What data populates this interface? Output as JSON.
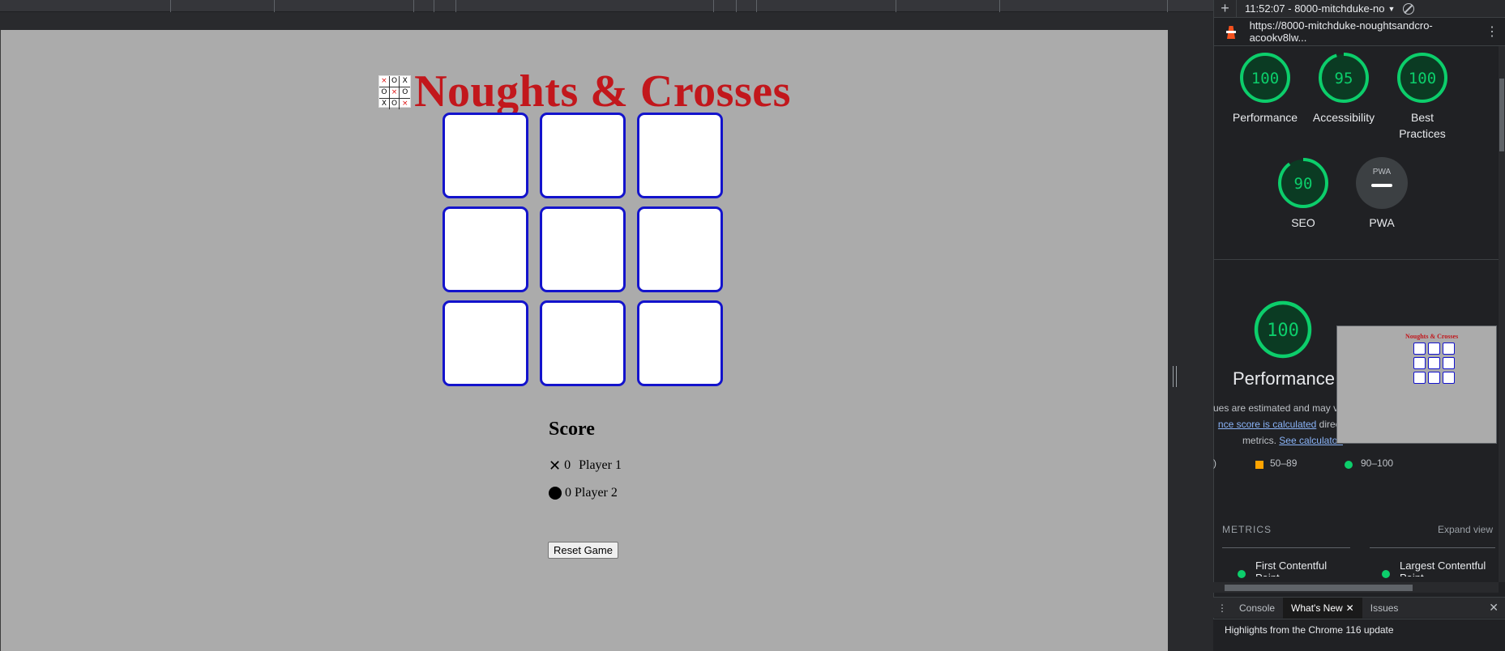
{
  "page": {
    "title": "Noughts & Crosses",
    "logo_cells": [
      "×",
      "O",
      "X",
      "O",
      "×",
      "O",
      "X",
      "O",
      "×"
    ],
    "score_heading": "Score",
    "player1": {
      "count": "0",
      "label": "Player 1",
      "symbol": "✕"
    },
    "player2": {
      "count": "0",
      "label": "Player 2"
    },
    "reset_label": "Reset Game"
  },
  "devtools": {
    "session": "11:52:07 - 8000-mitchduke-no",
    "url": "https://8000-mitchduke-noughtsandcro-acookv8lw...",
    "gauges": [
      {
        "score": 100,
        "label": "Performance"
      },
      {
        "score": 95,
        "label": "Accessibility"
      },
      {
        "score": 100,
        "label": "Best Practices"
      },
      {
        "score": 90,
        "label": "SEO"
      },
      {
        "score": null,
        "label": "PWA"
      }
    ],
    "pwa_badge": "PWA",
    "performance": {
      "score": "100",
      "title": "Performance",
      "note_line1": "ues are estimated and may va",
      "note_link1": "nce score is calculated",
      "note_line2_rest": " direct",
      "note_line3": "metrics. ",
      "note_link2": "See calculator."
    },
    "legend": {
      "mid": "50–89",
      "high": "90–100",
      "low_fragment": ")"
    },
    "metrics_heading": "METRICS",
    "expand_label": "Expand view",
    "metric1": "First Contentful",
    "metric1b": "Paint",
    "metric2": "Largest Contentful",
    "metric2b": "Paint",
    "drawer_tabs": [
      "Console",
      "What's New",
      "Issues"
    ],
    "drawer_text": "Highlights from the Chrome 116 update"
  },
  "colors": {
    "title": "#c2171c",
    "cell_border": "#1313cc",
    "gauge_green": "#0cce6b"
  }
}
